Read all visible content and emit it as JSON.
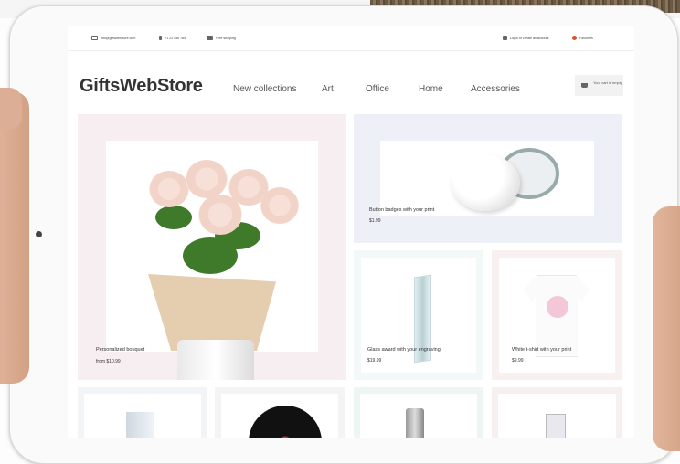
{
  "topbar": {
    "email": "info@giftswebstore.com",
    "phone": "+1 23 456 789",
    "shipping": "Free shipping",
    "login": "Login or create an account",
    "favorites": "Favorites"
  },
  "header": {
    "logo": "GiftsWebStore",
    "nav": [
      "New collections",
      "Art",
      "Office",
      "Home",
      "Accessories"
    ],
    "cart": "Your cart is empty"
  },
  "products": [
    {
      "name": "Personalized bouquet",
      "price": "from $10.99"
    },
    {
      "name": "Button badges with your print",
      "price": "$1.99"
    },
    {
      "name": "Glass award with your engraving",
      "price": "$19.99"
    },
    {
      "name": "White t-shirt with your print",
      "price": "$9.99"
    }
  ],
  "icons": {
    "email": "mail-icon",
    "phone": "phone-icon",
    "shipping": "truck-icon",
    "login": "login-icon",
    "favorites": "heart-icon",
    "cart": "cart-icon"
  },
  "colors": {
    "favorites": "#e0502a",
    "bouquet_bg": "#f7eef1",
    "badge_bg": "#eef0f7"
  }
}
